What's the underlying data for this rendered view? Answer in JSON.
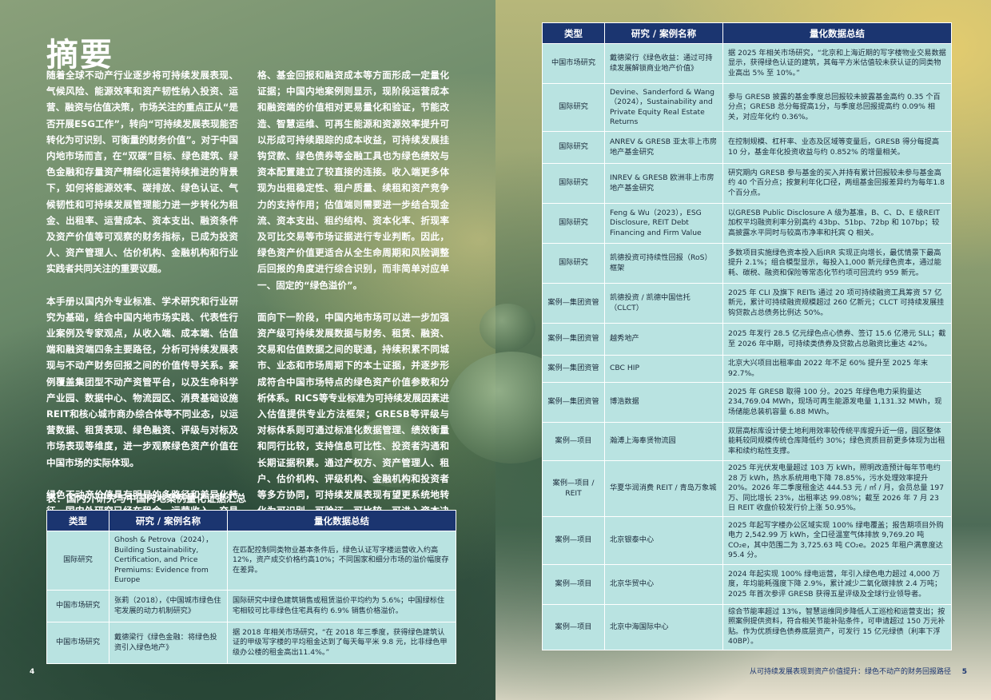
{
  "title": "摘要",
  "col1": {
    "p1": "随着全球不动产行业逐步将可持续发展表现、气候风险、能源效率和资产韧性纳入投资、运营、融资与估值决策，市场关注的重点正从“是否开展ESG工作”，转向“可持续发展表现能否转化为可识别、可衡量的财务价值”。对于中国内地市场而言，在“双碳”目标、绿色建筑、绿色金融和存量资产精细化运营持续推进的背景下，如何将能源效率、碳排放、绿色认证、气候韧性和可持续发展管理能力进一步转化为租金、出租率、运营成本、资本支出、融资条件及资产价值等可观察的财务指标，已成为投资人、资产管理人、估价机构、金融机构和行业实践者共同关注的重要议题。",
    "p2": "本手册以国内外专业标准、学术研究和行业研究为基础，结合中国内地市场实践、代表性行业案例及专家观点，从收入端、成本端、估值端和融资端四条主要路径，分析可持续发展表现与不动产财务回报之间的价值传导关系。案例覆盖集团型不动产资管平台，以及生命科学产业园、数据中心、物流园区、消费基础设施REIT和核心城市商办综合体等不同业态，以运营数据、租赁表现、绿色融资、评级与对标及市场表现等维度，进一步观察绿色资产价值在中国市场的实际体现。",
    "p3": "绿色不动产价值具有明显的多路径和差异化特征。国内外研究已经在租金、运营收入、交易价"
  },
  "col2": {
    "p1": "格、基金回报和融资成本等方面形成一定量化证据；中国内地案例则显示，现阶段运营成本和融资端的价值相对更易量化和验证，节能改造、智慧运维、可再生能源和资源效率提升可以形成可持续跟踪的成本收益，可持续发展挂钩贷款、绿色债券等金融工具也为绿色绩效与资本配置建立了较直接的连接。收入端更多体现为出租稳定性、租户质量、续租和资产竞争力的支持作用；估值端则需要进一步结合现金流、资本支出、租约结构、资本化率、折现率及可比交易等市场证据进行专业判断。因此，绿色资产价值更适合从全生命周期和风险调整后回报的角度进行综合识别，而非简单对应单一、固定的“绿色溢价”。",
    "p2": "面向下一阶段，中国内地市场可以进一步加强资产级可持续发展数据与财务、租赁、融资、交易和估值数据之间的联通，持续积累不同城市、业态和市场周期下的本土证据，并逐步形成符合中国市场特点的绿色资产价值参数和分析体系。RICS等专业标准为可持续发展因素进入估值提供专业方法框架；GRESB等评级与对标体系则可通过标准化数据管理、绩效衡量和同行比较，支持信息可比性、投资者沟通和长期证据积累。通过产权方、资产管理人、租户、估价机构、评级机构、金融机构和投资者等多方协同，可持续发展表现有望更系统地转化为可识别、可验证、可比较、可进入资本决策的财务价值。"
  },
  "table_title": "表：国内外研究与中国内地案例量化证据汇总",
  "headers": {
    "type": "类型",
    "name": "研究 / 案例名称",
    "summary": "量化数据总结"
  },
  "left_rows": [
    {
      "type": "国际研究",
      "name": "Ghosh & Petrova（2024），Building Sustainability, Certification, and Price Premiums: Evidence from Europe",
      "summary": "在匹配控制同类物业基本条件后，绿色认证写字楼运营收入约高12%，资产成交价格约高10%；不同国家和细分市场的溢价幅度存在差异。"
    },
    {
      "type": "中国市场研究",
      "name": "张莉（2018），《中国城市绿色住宅发展的动力机制研究》",
      "summary": "国际研究中绿色建筑销售或租赁溢价平均约为 5.6%；中国绿标住宅相较可比非绿色住宅具有约 6.9% 销售价格溢价。"
    },
    {
      "type": "中国市场研究",
      "name": "戴德梁行《绿色金融：将绿色投资引入绿色地产》",
      "summary": "据 2018 年相关市场研究，“在 2018 年三季度，获得绿色建筑认证的甲级写字楼的平均租金达到了每天每平米 9.8 元，比非绿色甲级办公楼的租金高出11.4%。”"
    }
  ],
  "right_rows": [
    {
      "type": "中国市场研究",
      "name": "戴德梁行《绿色收益：通过可持续发展解锁商业地产价值》",
      "summary": "据 2025 年相关市场研究，“北京和上海近期的写字楼物业交易数据显示，获得绿色认证的建筑，其每平方米估值较未获认证的同类物业高出 5% 至 10%。”"
    },
    {
      "type": "国际研究",
      "name": "Devine、Sanderford & Wang（2024），Sustainability and Private Equity Real Estate Returns",
      "summary": "参与 GRESB 披露的基金季度总回报较未披露基金高约 0.35 个百分点；GRESB 总分每提高1分，与季度总回报提高约 0.09% 相关，对应年化约 0.36%。"
    },
    {
      "type": "国际研究",
      "name": "ANREV & GRESB 亚太非上市房地产基金研究",
      "summary": "在控制规模、杠杆率、业态及区域等变量后，GRESB 得分每提高10 分，基金年化投资收益与约 0.852% 的增量相关。"
    },
    {
      "type": "国际研究",
      "name": "INREV & GRESB 欧洲非上市房地产基金研究",
      "summary": "研究期内 GRESB 参与基金的买入并持有累计回报较未参与基金高约 40 个百分点；按复利年化口径，两组基金回报差异约为每年1.8 个百分点。"
    },
    {
      "type": "国际研究",
      "name": "Feng & Wu（2023），ESG Disclosure, REIT Debt Financing and Firm Value",
      "summary": "以GRESB Public Disclosure A 级为基准，B、C、D、E 级REIT 加权平均融资利率分别高约 43bp、51bp、72bp 和 107bp；较高披露水平同时与较高市净率和托宾 Q 相关。"
    },
    {
      "type": "国际研究",
      "name": "凯德投资可持续性回报（RoS）框架",
      "summary": "多数项目实施绿色资本投入后IRR 实现正向增长，最优情景下最高提升 2.1%；组合模型显示，每投入1,000 新元绿色资本，通过能耗、碳税、融资和保险等常态化节约项可回流约 959 新元。"
    },
    {
      "type": "案例—集团资管",
      "name": "凯德投资 / 凯德中国信托（CLCT）",
      "summary": "2025 年 CLI 及旗下 REITs 通过 20 项可持续融资工具筹资 57 亿新元，累计可持续融资规模超过 260 亿新元；CLCT 可持续发展挂钩贷款占总债务比例达 50%。"
    },
    {
      "type": "案例—集团资管",
      "name": "越秀地产",
      "summary": "2025 年发行 28.5 亿元绿色点心债券、签订 15.6 亿港元 SLL；截至 2026 年中期，可持续类债券及贷款占总融资比重达 42%。"
    },
    {
      "type": "案例—集团资管",
      "name": "CBC HIP",
      "summary": "北京大兴项目出租率由 2022 年不足 60% 提升至 2025 年末 92.7%。"
    },
    {
      "type": "案例—集团资管",
      "name": "博浩数据",
      "summary": "2025 年 GRESB 取得 100 分。2025 年绿色电力采购量达 234,769.04 MWh，现场可再生能源发电量 1,131.32 MWh，现场储能总装机容量 6.88 MWh。"
    },
    {
      "type": "案例—项目",
      "name": "瀚溥上海奉贤物流园",
      "summary": "双层高标库设计使土地利用效率较传统平库提升近一倍，园区整体能耗较同规模传统仓库降低约 30%；绿色资质目前更多体现为出租率和续约粘性支撑。"
    },
    {
      "type": "案例—项目 / REIT",
      "name": "华夏华润消费 REIT / 青岛万象城",
      "summary": "2025 年光伏发电量超过 103 万 kWh，照明改造预计每年节电约 28 万 kWh，热水系统用电下降 78.85%，污水处理效率提升 20%。2026 年二季度租金达 444.53 元 / ㎡ / 月，会员总量 197 万、同比增长 23%，出租率达 99.08%；截至 2026 年 7 月 23 日 REIT 收盘价较发行价上涨 50.95%。"
    },
    {
      "type": "案例—项目",
      "name": "北京银泰中心",
      "summary": "2025 年起写字楼办公区域实现 100% 绿电覆盖；报告期项目外购电力 2,542.99 万 kWh，全口径温室气体排放 9,769.20 吨 CO₂e，其中范围二为 3,725.63 吨 CO₂e。2025 年租户满意度达 95.4 分。"
    },
    {
      "type": "案例—项目",
      "name": "北京华贸中心",
      "summary": "2024 年起实现 100% 绿电运营，年引入绿色电力超过 4,000 万度，年均能耗强度下降 2.9%，累计减少二氧化碳排放 2.4 万吨；2025 年首次参评 GRESB 获得五星评级及全球行业领导者。"
    },
    {
      "type": "案例—项目",
      "name": "北京中海国际中心",
      "summary": "综合节能率超过 13%，智慧运维同步降低人工巡检和运营支出；按照案例提供资料，符合相关节能补贴条件，可申请超过 150 万元补贴。作为优质绿色债券底层资产，可发行 15 亿元绿债（利率下浮 40BP）。"
    }
  ],
  "page_left": "4",
  "page_right": "5",
  "footer": "从可持续发展表现到资产价值提升：绿色不动产的财务回报路径"
}
